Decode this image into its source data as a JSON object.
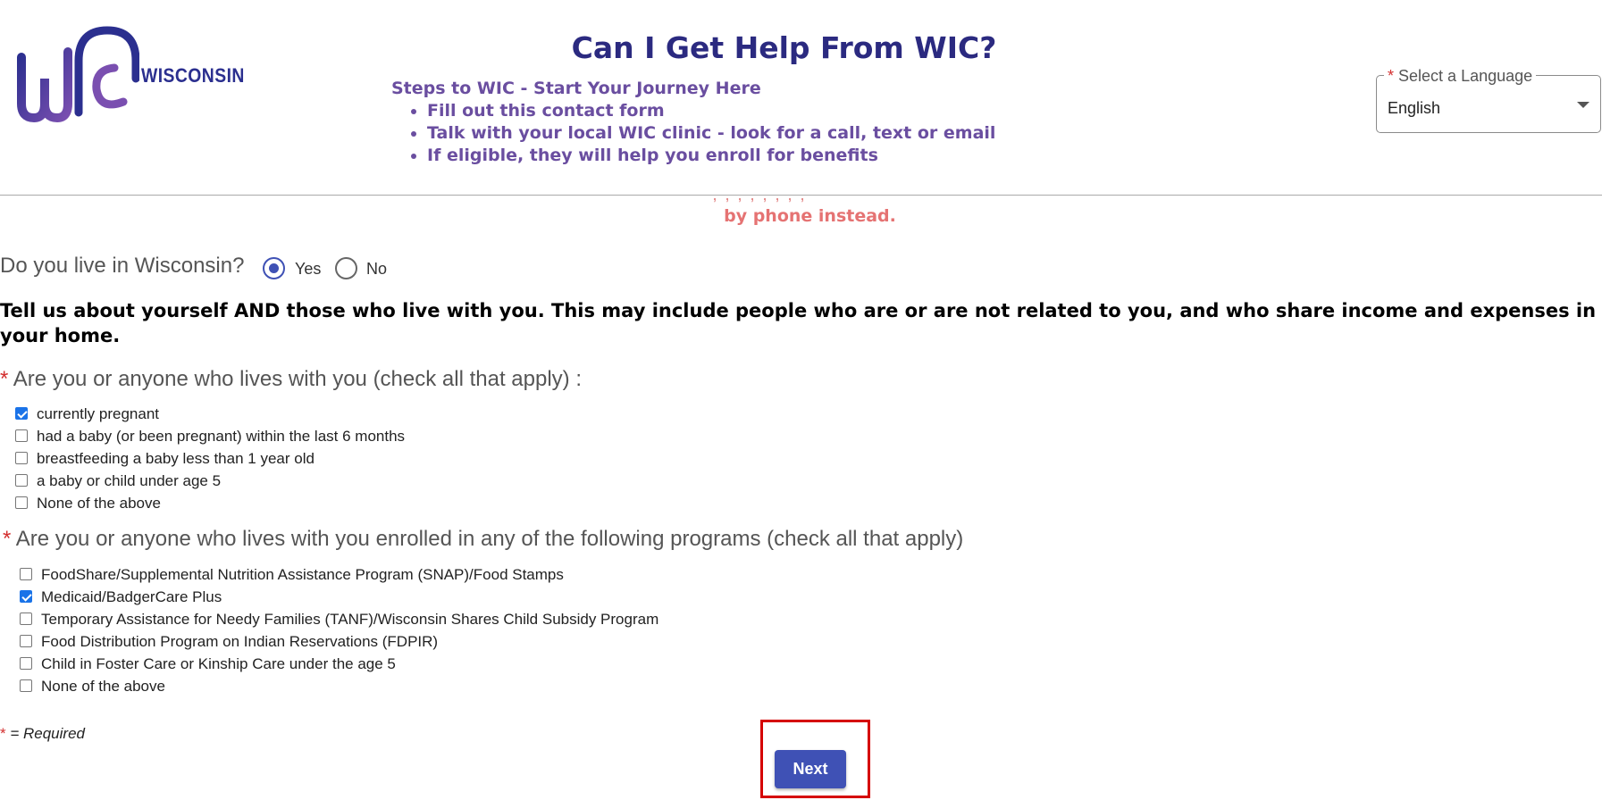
{
  "header": {
    "logo_text": "WIC",
    "logo_state": "WISCONSIN",
    "title": "Can I Get Help From WIC?",
    "steps_title": "Steps to WIC - Start Your Journey Here",
    "steps": [
      "Fill out this contact form",
      "Talk with your local WIC clinic - look for a call, text or email",
      "If eligible, they will help you enroll for benefits"
    ]
  },
  "language": {
    "required_marker": "*",
    "label": "Select a Language",
    "value": "English"
  },
  "notice": {
    "text": "by phone instead."
  },
  "wisconsin_question": {
    "label": "Do you live in Wisconsin?",
    "options": [
      {
        "label": "Yes",
        "selected": true
      },
      {
        "label": "No",
        "selected": false
      }
    ]
  },
  "household_instructions": "Tell us about yourself AND those who live with you. This may include people who are or are not related to you, and who share income and expenses in your home.",
  "status_question": {
    "required_marker": "*",
    "label": "Are you or anyone who lives with you (check all that apply) :",
    "options": [
      {
        "label": "currently pregnant",
        "checked": true
      },
      {
        "label": "had a baby (or been pregnant) within the last 6 months",
        "checked": false
      },
      {
        "label": "breastfeeding a baby less than 1 year old",
        "checked": false
      },
      {
        "label": "a baby or child under age 5",
        "checked": false
      },
      {
        "label": "None of the above",
        "checked": false
      }
    ]
  },
  "programs_question": {
    "required_marker": "*",
    "label": "Are you or anyone who lives with you enrolled in any of the following programs (check all that apply)",
    "options": [
      {
        "label": "FoodShare/Supplemental Nutrition Assistance Program (SNAP)/Food Stamps",
        "checked": false
      },
      {
        "label": "Medicaid/BadgerCare Plus",
        "checked": true
      },
      {
        "label": "Temporary Assistance for Needy Families (TANF)/Wisconsin Shares Child Subsidy Program",
        "checked": false
      },
      {
        "label": "Food Distribution Program on Indian Reservations (FDPIR)",
        "checked": false
      },
      {
        "label": "Child in Foster Care or Kinship Care under the age 5",
        "checked": false
      },
      {
        "label": "None of the above",
        "checked": false
      }
    ]
  },
  "required_note": {
    "marker": "*",
    "text": " = Required"
  },
  "next_button": "Next",
  "colors": {
    "title": "#2b2a80",
    "steps": "#6a4ea0",
    "notice": "#e57373",
    "primary": "#3f51b5",
    "highlight": "#d50000",
    "required": "#d32f2f"
  }
}
